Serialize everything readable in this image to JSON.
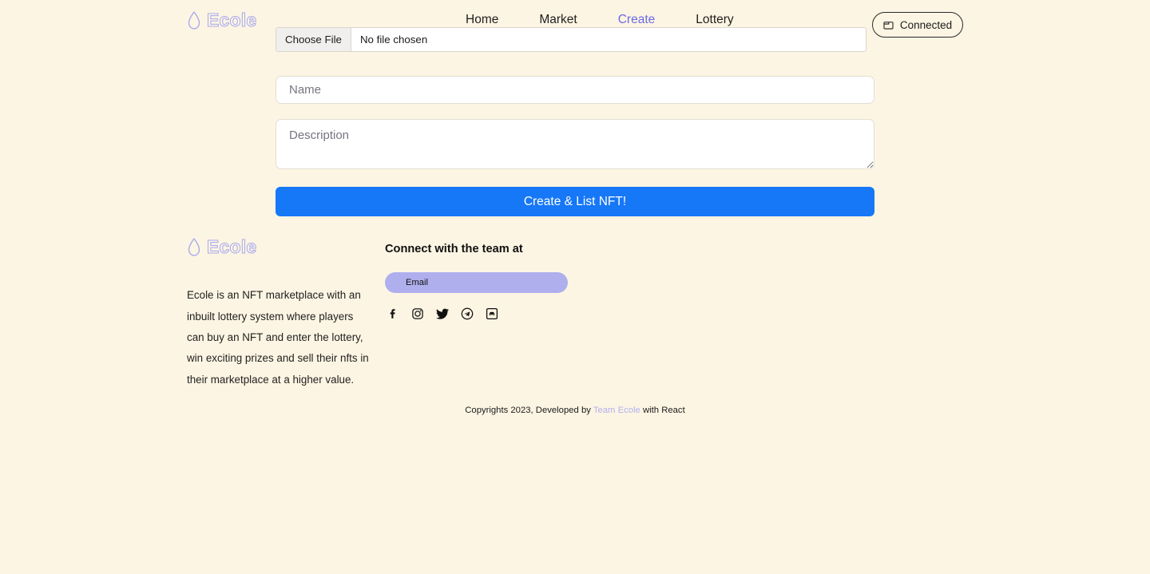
{
  "brand": {
    "name": "Ecole",
    "logo_icon": "water-drop-icon"
  },
  "nav": {
    "items": [
      {
        "label": "Home",
        "active": false
      },
      {
        "label": "Market",
        "active": false
      },
      {
        "label": "Create",
        "active": true
      },
      {
        "label": "Lottery",
        "active": false
      }
    ]
  },
  "wallet": {
    "label": "Connected",
    "icon": "wallet-icon"
  },
  "form": {
    "file_button_label": "Choose File",
    "file_status": "No file chosen",
    "name_placeholder": "Name",
    "name_value": "",
    "description_placeholder": "Description",
    "description_value": "",
    "submit_label": "Create & List NFT!"
  },
  "footer": {
    "brand_name": "Ecole",
    "description": "Ecole is an NFT marketplace with an inbuilt lottery system where players can buy an NFT and enter the lottery, win exciting prizes and sell their nfts in their marketplace at a higher value.",
    "connect_title": "Connect with the team at",
    "email_label": "Email",
    "socials": [
      {
        "name": "facebook-icon",
        "label": "Facebook"
      },
      {
        "name": "instagram-icon",
        "label": "Instagram"
      },
      {
        "name": "twitter-icon",
        "label": "Twitter"
      },
      {
        "name": "telegram-icon",
        "label": "Telegram"
      },
      {
        "name": "discord-icon",
        "label": "Discord"
      }
    ],
    "copyright_prefix": "Copyrights 2023, Developed by ",
    "copyright_team": "Team Ecole",
    "copyright_suffix": " with React"
  },
  "colors": {
    "background": "#fdf5e3",
    "accent_blue": "#1677f7",
    "brand_periwinkle": "#afafee",
    "active_nav": "#6b6be4"
  }
}
